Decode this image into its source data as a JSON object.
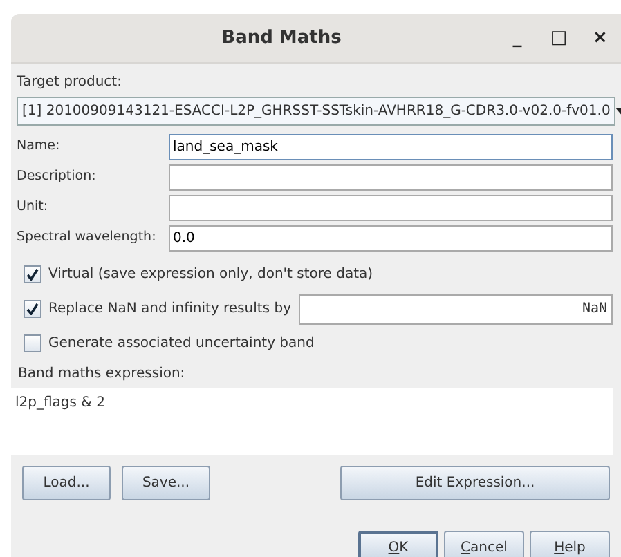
{
  "window": {
    "title": "Band Maths",
    "controls": [
      "_",
      "□",
      "×"
    ]
  },
  "target_product": {
    "label": "Target product:",
    "value": "[1] 20100909143121-ESACCI-L2P_GHRSST-SSTskin-AVHRR18_G-CDR3.0-v02.0-fv01.0"
  },
  "fields": [
    {
      "label": "Name:",
      "value": "land_sea_mask",
      "focused": true
    },
    {
      "label": "Description:",
      "focused": false
    },
    {
      "label": "Unit:",
      "focused": false
    },
    {
      "label": "Spectral wavelength:",
      "value": "0.0",
      "focused": false
    }
  ],
  "options": [
    {
      "label": "Virtual (save expression only, don't store data)",
      "checked": true
    },
    {
      "label": "Replace NaN and infinity results by",
      "checked": true,
      "value": "NaN"
    },
    {
      "label": "Generate associated uncertainty band",
      "checked": false
    }
  ],
  "expression": {
    "label": "Band maths expression:",
    "value": "l2p_flags & 2"
  },
  "expression_buttons": [
    {
      "label": "Load..."
    },
    {
      "label": "Save..."
    },
    {
      "label": "Edit Expression..."
    }
  ],
  "dialog_buttons": [
    {
      "label": "OK",
      "default": true
    },
    {
      "label": "Cancel",
      "default": false
    },
    {
      "label": "Help",
      "default": false
    }
  ]
}
